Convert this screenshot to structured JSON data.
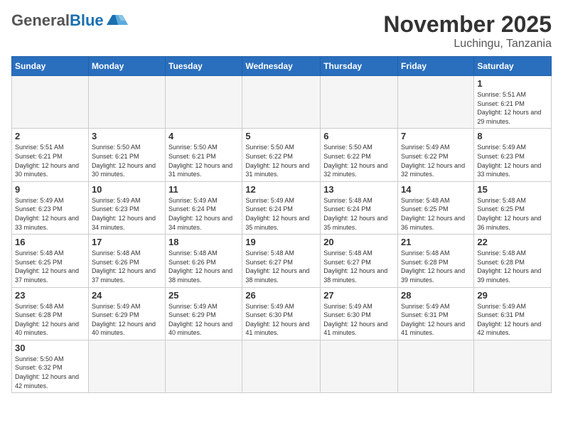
{
  "header": {
    "logo_general": "General",
    "logo_blue": "Blue",
    "month_title": "November 2025",
    "location": "Luchingu, Tanzania"
  },
  "weekdays": [
    "Sunday",
    "Monday",
    "Tuesday",
    "Wednesday",
    "Thursday",
    "Friday",
    "Saturday"
  ],
  "weeks": [
    [
      null,
      null,
      null,
      null,
      null,
      null,
      {
        "day": "1",
        "sunrise": "Sunrise: 5:51 AM",
        "sunset": "Sunset: 6:21 PM",
        "daylight": "Daylight: 12 hours and 29 minutes."
      }
    ],
    [
      {
        "day": "2",
        "sunrise": "Sunrise: 5:51 AM",
        "sunset": "Sunset: 6:21 PM",
        "daylight": "Daylight: 12 hours and 30 minutes."
      },
      {
        "day": "3",
        "sunrise": "Sunrise: 5:50 AM",
        "sunset": "Sunset: 6:21 PM",
        "daylight": "Daylight: 12 hours and 30 minutes."
      },
      {
        "day": "4",
        "sunrise": "Sunrise: 5:50 AM",
        "sunset": "Sunset: 6:21 PM",
        "daylight": "Daylight: 12 hours and 31 minutes."
      },
      {
        "day": "5",
        "sunrise": "Sunrise: 5:50 AM",
        "sunset": "Sunset: 6:22 PM",
        "daylight": "Daylight: 12 hours and 31 minutes."
      },
      {
        "day": "6",
        "sunrise": "Sunrise: 5:50 AM",
        "sunset": "Sunset: 6:22 PM",
        "daylight": "Daylight: 12 hours and 32 minutes."
      },
      {
        "day": "7",
        "sunrise": "Sunrise: 5:49 AM",
        "sunset": "Sunset: 6:22 PM",
        "daylight": "Daylight: 12 hours and 32 minutes."
      },
      {
        "day": "8",
        "sunrise": "Sunrise: 5:49 AM",
        "sunset": "Sunset: 6:23 PM",
        "daylight": "Daylight: 12 hours and 33 minutes."
      }
    ],
    [
      {
        "day": "9",
        "sunrise": "Sunrise: 5:49 AM",
        "sunset": "Sunset: 6:23 PM",
        "daylight": "Daylight: 12 hours and 33 minutes."
      },
      {
        "day": "10",
        "sunrise": "Sunrise: 5:49 AM",
        "sunset": "Sunset: 6:23 PM",
        "daylight": "Daylight: 12 hours and 34 minutes."
      },
      {
        "day": "11",
        "sunrise": "Sunrise: 5:49 AM",
        "sunset": "Sunset: 6:24 PM",
        "daylight": "Daylight: 12 hours and 34 minutes."
      },
      {
        "day": "12",
        "sunrise": "Sunrise: 5:49 AM",
        "sunset": "Sunset: 6:24 PM",
        "daylight": "Daylight: 12 hours and 35 minutes."
      },
      {
        "day": "13",
        "sunrise": "Sunrise: 5:48 AM",
        "sunset": "Sunset: 6:24 PM",
        "daylight": "Daylight: 12 hours and 35 minutes."
      },
      {
        "day": "14",
        "sunrise": "Sunrise: 5:48 AM",
        "sunset": "Sunset: 6:25 PM",
        "daylight": "Daylight: 12 hours and 36 minutes."
      },
      {
        "day": "15",
        "sunrise": "Sunrise: 5:48 AM",
        "sunset": "Sunset: 6:25 PM",
        "daylight": "Daylight: 12 hours and 36 minutes."
      }
    ],
    [
      {
        "day": "16",
        "sunrise": "Sunrise: 5:48 AM",
        "sunset": "Sunset: 6:25 PM",
        "daylight": "Daylight: 12 hours and 37 minutes."
      },
      {
        "day": "17",
        "sunrise": "Sunrise: 5:48 AM",
        "sunset": "Sunset: 6:26 PM",
        "daylight": "Daylight: 12 hours and 37 minutes."
      },
      {
        "day": "18",
        "sunrise": "Sunrise: 5:48 AM",
        "sunset": "Sunset: 6:26 PM",
        "daylight": "Daylight: 12 hours and 38 minutes."
      },
      {
        "day": "19",
        "sunrise": "Sunrise: 5:48 AM",
        "sunset": "Sunset: 6:27 PM",
        "daylight": "Daylight: 12 hours and 38 minutes."
      },
      {
        "day": "20",
        "sunrise": "Sunrise: 5:48 AM",
        "sunset": "Sunset: 6:27 PM",
        "daylight": "Daylight: 12 hours and 38 minutes."
      },
      {
        "day": "21",
        "sunrise": "Sunrise: 5:48 AM",
        "sunset": "Sunset: 6:28 PM",
        "daylight": "Daylight: 12 hours and 39 minutes."
      },
      {
        "day": "22",
        "sunrise": "Sunrise: 5:48 AM",
        "sunset": "Sunset: 6:28 PM",
        "daylight": "Daylight: 12 hours and 39 minutes."
      }
    ],
    [
      {
        "day": "23",
        "sunrise": "Sunrise: 5:48 AM",
        "sunset": "Sunset: 6:28 PM",
        "daylight": "Daylight: 12 hours and 40 minutes."
      },
      {
        "day": "24",
        "sunrise": "Sunrise: 5:49 AM",
        "sunset": "Sunset: 6:29 PM",
        "daylight": "Daylight: 12 hours and 40 minutes."
      },
      {
        "day": "25",
        "sunrise": "Sunrise: 5:49 AM",
        "sunset": "Sunset: 6:29 PM",
        "daylight": "Daylight: 12 hours and 40 minutes."
      },
      {
        "day": "26",
        "sunrise": "Sunrise: 5:49 AM",
        "sunset": "Sunset: 6:30 PM",
        "daylight": "Daylight: 12 hours and 41 minutes."
      },
      {
        "day": "27",
        "sunrise": "Sunrise: 5:49 AM",
        "sunset": "Sunset: 6:30 PM",
        "daylight": "Daylight: 12 hours and 41 minutes."
      },
      {
        "day": "28",
        "sunrise": "Sunrise: 5:49 AM",
        "sunset": "Sunset: 6:31 PM",
        "daylight": "Daylight: 12 hours and 41 minutes."
      },
      {
        "day": "29",
        "sunrise": "Sunrise: 5:49 AM",
        "sunset": "Sunset: 6:31 PM",
        "daylight": "Daylight: 12 hours and 42 minutes."
      }
    ],
    [
      {
        "day": "30",
        "sunrise": "Sunrise: 5:50 AM",
        "sunset": "Sunset: 6:32 PM",
        "daylight": "Daylight: 12 hours and 42 minutes."
      },
      null,
      null,
      null,
      null,
      null,
      null
    ]
  ]
}
